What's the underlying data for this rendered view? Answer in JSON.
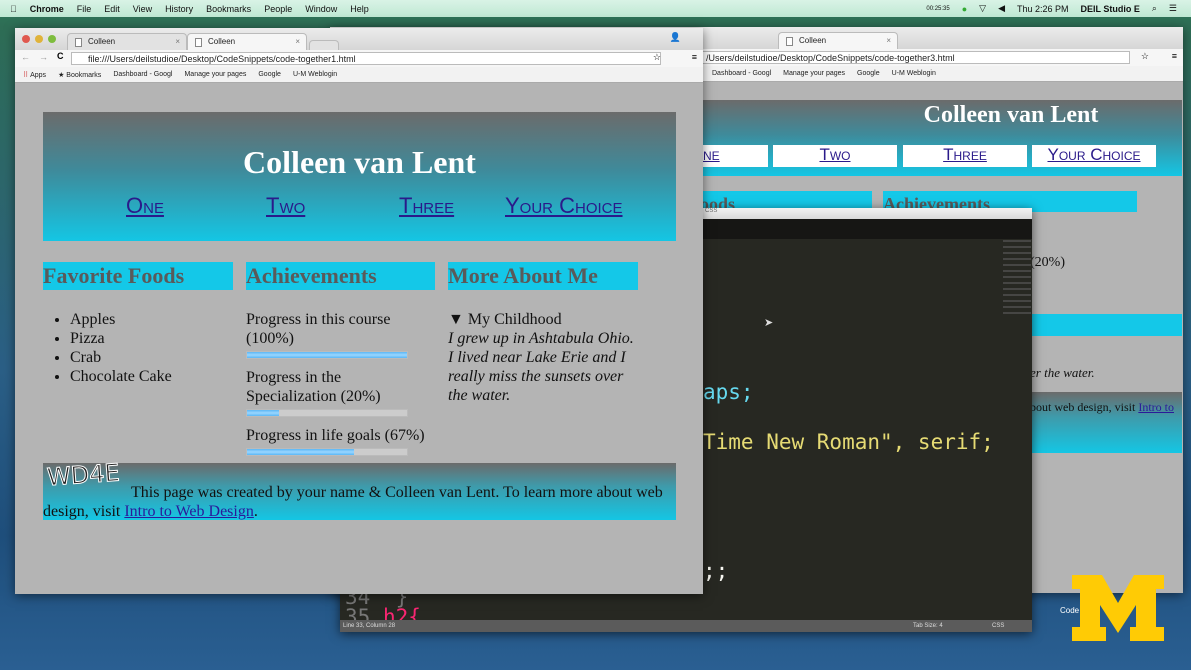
{
  "menubar": {
    "app": "Chrome",
    "items": [
      "File",
      "Edit",
      "View",
      "History",
      "Bookmarks",
      "People",
      "Window",
      "Help"
    ],
    "clock": "Thu 2:26 PM",
    "user": "DEIL Studio E",
    "recording": "00:25:35"
  },
  "left_browser": {
    "tabs": [
      {
        "label": "Colleen"
      },
      {
        "label": "Colleen"
      }
    ],
    "url": "file:///Users/deilstudioe/Desktop/CodeSnippets/code-together1.html",
    "bookmarks": [
      "Apps",
      "Bookmarks",
      "Dashboard - Googl",
      "Manage your pages",
      "Google",
      "U-M Weblogin"
    ],
    "page": {
      "title": "Colleen van Lent",
      "nav": [
        "One",
        "Two",
        "Three",
        "Your Choice"
      ],
      "sections": {
        "foods": {
          "heading": "Favorite Foods",
          "items": [
            "Apples",
            "Pizza",
            "Crab",
            "Chocolate Cake"
          ]
        },
        "achievements": {
          "heading": "Achievements",
          "progress": [
            {
              "label": "Progress in this course (100%)",
              "value": 100
            },
            {
              "label": "Progress in the Specialization (20%)",
              "value": 20
            },
            {
              "label": "Progress in life goals (67%)",
              "value": 67
            }
          ]
        },
        "about": {
          "heading": "More About Me",
          "summary": "My Childhood",
          "text": "I grew up in Ashtabula Ohio. I lived near Lake Erie and I really miss the sunsets over the water."
        }
      },
      "footer": {
        "logo": "WD4E",
        "text": "This page was created by your name & Colleen van Lent. To learn more about web design, visit ",
        "link": "Intro to Web Design",
        "end": "."
      }
    }
  },
  "right_browser": {
    "tabs": [
      {
        "label": "Colleen"
      }
    ],
    "url": "/Users/deilstudioe/Desktop/CodeSnippets/code-together3.html",
    "bookmarks": [
      "Dashboard - Googl",
      "Manage your pages",
      "Google",
      "U-M Weblogin"
    ],
    "page": {
      "title": "Colleen van Lent",
      "nav": [
        "ne",
        "Two",
        "Three",
        "Your Choice"
      ],
      "headings": [
        "oods",
        "Achievements"
      ],
      "frag1": "0",
      "frag2": "(20%)",
      "frag3": "er the water.",
      "footer_text": "bout web design, visit ",
      "footer_link": "Intro to"
    }
  },
  "editor": {
    "title": "CSS",
    "lines": [
      "aps;",
      "Time New Roman\", serif;",
      ";;"
    ],
    "line34": "34  }",
    "line35": "35",
    "line35_code": "h2{",
    "status": {
      "position": "Line 33, Column 28",
      "tab_size": "Tab Size: 4",
      "syntax": "CSS"
    }
  },
  "desktop": {
    "icon_label": "Code"
  },
  "colors": {
    "accent": "#14c8e8",
    "link": "#2a1a8a",
    "logo": "#ffcb05"
  }
}
